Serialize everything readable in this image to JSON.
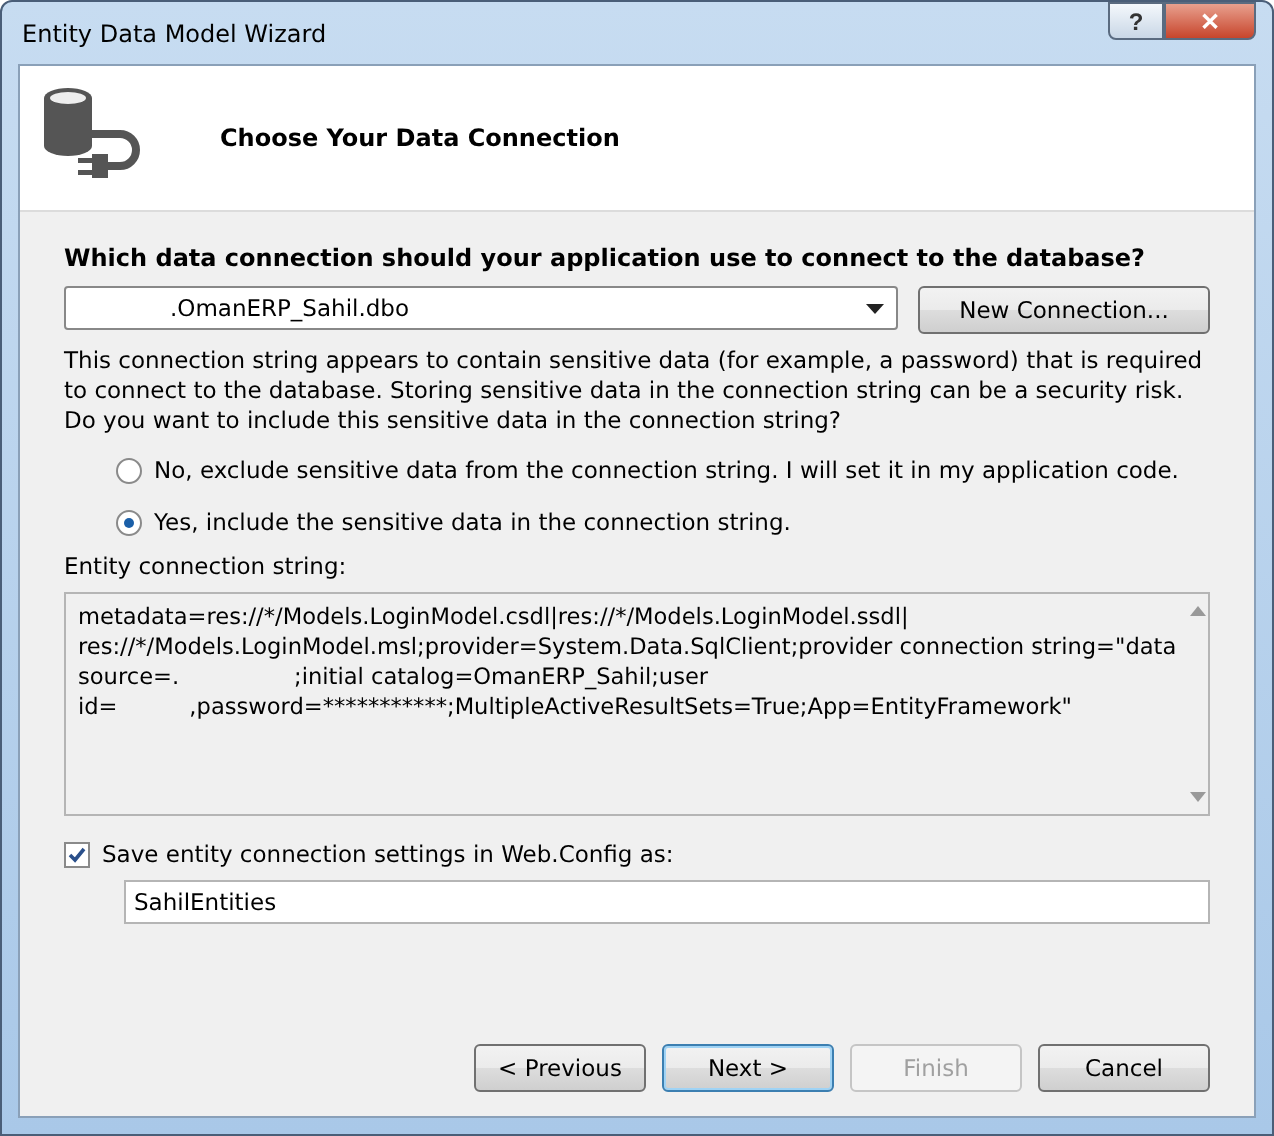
{
  "window": {
    "title": "Entity Data Model Wizard",
    "buttons": [
      "?",
      "✕"
    ]
  },
  "header": {
    "title": "Choose Your Data Connection"
  },
  "question": "Which data connection should your application use to connect to the database?",
  "connection": {
    "value": ".OmanERP_Sahil.dbo",
    "button": "New Connection..."
  },
  "warning": "This connection string appears to contain sensitive data (for example, a password) that is required to connect to the database. Storing sensitive data in the connection string can be a security risk. Do you want to include this sensitive data in the connection string?",
  "options": [
    {
      "label": "No, exclude sensitive data from the connection string. I will set it in my application code.",
      "selected": false
    },
    {
      "label": "Yes, include the sensitive data in the connection string.",
      "selected": true
    }
  ],
  "connection_string": {
    "label": "Entity connection string:",
    "lines": [
      "metadata=res://*/Models.LoginModel.csdl|res://*/Models.LoginModel.ssdl|",
      "res://*/Models.LoginModel.msl;provider=System.Data.SqlClient;provider connection string=\"data",
      "source=.                ;initial catalog=OmanERP_Sahil;user",
      "id=          ,password=***********;MultipleActiveResultSets=True;App=EntityFramework\""
    ]
  },
  "save": {
    "label": "Save entity connection settings in Web.Config as:",
    "checked": true,
    "value": "SahilEntities"
  },
  "buttons": [
    {
      "label": "< Previous",
      "disabled": false,
      "default": false
    },
    {
      "label": "Next >",
      "disabled": false,
      "default": true
    },
    {
      "label": "Finish",
      "disabled": true,
      "default": false
    },
    {
      "label": "Cancel",
      "disabled": false,
      "default": false
    }
  ]
}
